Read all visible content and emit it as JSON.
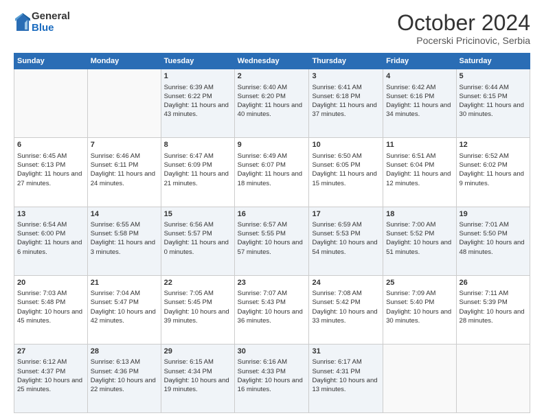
{
  "logo": {
    "general": "General",
    "blue": "Blue"
  },
  "title": "October 2024",
  "location": "Pocerski Pricinovic, Serbia",
  "days_of_week": [
    "Sunday",
    "Monday",
    "Tuesday",
    "Wednesday",
    "Thursday",
    "Friday",
    "Saturday"
  ],
  "weeks": [
    [
      {
        "day": "",
        "sunrise": "",
        "sunset": "",
        "daylight": ""
      },
      {
        "day": "",
        "sunrise": "",
        "sunset": "",
        "daylight": ""
      },
      {
        "day": "1",
        "sunrise": "Sunrise: 6:39 AM",
        "sunset": "Sunset: 6:22 PM",
        "daylight": "Daylight: 11 hours and 43 minutes."
      },
      {
        "day": "2",
        "sunrise": "Sunrise: 6:40 AM",
        "sunset": "Sunset: 6:20 PM",
        "daylight": "Daylight: 11 hours and 40 minutes."
      },
      {
        "day": "3",
        "sunrise": "Sunrise: 6:41 AM",
        "sunset": "Sunset: 6:18 PM",
        "daylight": "Daylight: 11 hours and 37 minutes."
      },
      {
        "day": "4",
        "sunrise": "Sunrise: 6:42 AM",
        "sunset": "Sunset: 6:16 PM",
        "daylight": "Daylight: 11 hours and 34 minutes."
      },
      {
        "day": "5",
        "sunrise": "Sunrise: 6:44 AM",
        "sunset": "Sunset: 6:15 PM",
        "daylight": "Daylight: 11 hours and 30 minutes."
      }
    ],
    [
      {
        "day": "6",
        "sunrise": "Sunrise: 6:45 AM",
        "sunset": "Sunset: 6:13 PM",
        "daylight": "Daylight: 11 hours and 27 minutes."
      },
      {
        "day": "7",
        "sunrise": "Sunrise: 6:46 AM",
        "sunset": "Sunset: 6:11 PM",
        "daylight": "Daylight: 11 hours and 24 minutes."
      },
      {
        "day": "8",
        "sunrise": "Sunrise: 6:47 AM",
        "sunset": "Sunset: 6:09 PM",
        "daylight": "Daylight: 11 hours and 21 minutes."
      },
      {
        "day": "9",
        "sunrise": "Sunrise: 6:49 AM",
        "sunset": "Sunset: 6:07 PM",
        "daylight": "Daylight: 11 hours and 18 minutes."
      },
      {
        "day": "10",
        "sunrise": "Sunrise: 6:50 AM",
        "sunset": "Sunset: 6:05 PM",
        "daylight": "Daylight: 11 hours and 15 minutes."
      },
      {
        "day": "11",
        "sunrise": "Sunrise: 6:51 AM",
        "sunset": "Sunset: 6:04 PM",
        "daylight": "Daylight: 11 hours and 12 minutes."
      },
      {
        "day": "12",
        "sunrise": "Sunrise: 6:52 AM",
        "sunset": "Sunset: 6:02 PM",
        "daylight": "Daylight: 11 hours and 9 minutes."
      }
    ],
    [
      {
        "day": "13",
        "sunrise": "Sunrise: 6:54 AM",
        "sunset": "Sunset: 6:00 PM",
        "daylight": "Daylight: 11 hours and 6 minutes."
      },
      {
        "day": "14",
        "sunrise": "Sunrise: 6:55 AM",
        "sunset": "Sunset: 5:58 PM",
        "daylight": "Daylight: 11 hours and 3 minutes."
      },
      {
        "day": "15",
        "sunrise": "Sunrise: 6:56 AM",
        "sunset": "Sunset: 5:57 PM",
        "daylight": "Daylight: 11 hours and 0 minutes."
      },
      {
        "day": "16",
        "sunrise": "Sunrise: 6:57 AM",
        "sunset": "Sunset: 5:55 PM",
        "daylight": "Daylight: 10 hours and 57 minutes."
      },
      {
        "day": "17",
        "sunrise": "Sunrise: 6:59 AM",
        "sunset": "Sunset: 5:53 PM",
        "daylight": "Daylight: 10 hours and 54 minutes."
      },
      {
        "day": "18",
        "sunrise": "Sunrise: 7:00 AM",
        "sunset": "Sunset: 5:52 PM",
        "daylight": "Daylight: 10 hours and 51 minutes."
      },
      {
        "day": "19",
        "sunrise": "Sunrise: 7:01 AM",
        "sunset": "Sunset: 5:50 PM",
        "daylight": "Daylight: 10 hours and 48 minutes."
      }
    ],
    [
      {
        "day": "20",
        "sunrise": "Sunrise: 7:03 AM",
        "sunset": "Sunset: 5:48 PM",
        "daylight": "Daylight: 10 hours and 45 minutes."
      },
      {
        "day": "21",
        "sunrise": "Sunrise: 7:04 AM",
        "sunset": "Sunset: 5:47 PM",
        "daylight": "Daylight: 10 hours and 42 minutes."
      },
      {
        "day": "22",
        "sunrise": "Sunrise: 7:05 AM",
        "sunset": "Sunset: 5:45 PM",
        "daylight": "Daylight: 10 hours and 39 minutes."
      },
      {
        "day": "23",
        "sunrise": "Sunrise: 7:07 AM",
        "sunset": "Sunset: 5:43 PM",
        "daylight": "Daylight: 10 hours and 36 minutes."
      },
      {
        "day": "24",
        "sunrise": "Sunrise: 7:08 AM",
        "sunset": "Sunset: 5:42 PM",
        "daylight": "Daylight: 10 hours and 33 minutes."
      },
      {
        "day": "25",
        "sunrise": "Sunrise: 7:09 AM",
        "sunset": "Sunset: 5:40 PM",
        "daylight": "Daylight: 10 hours and 30 minutes."
      },
      {
        "day": "26",
        "sunrise": "Sunrise: 7:11 AM",
        "sunset": "Sunset: 5:39 PM",
        "daylight": "Daylight: 10 hours and 28 minutes."
      }
    ],
    [
      {
        "day": "27",
        "sunrise": "Sunrise: 6:12 AM",
        "sunset": "Sunset: 4:37 PM",
        "daylight": "Daylight: 10 hours and 25 minutes."
      },
      {
        "day": "28",
        "sunrise": "Sunrise: 6:13 AM",
        "sunset": "Sunset: 4:36 PM",
        "daylight": "Daylight: 10 hours and 22 minutes."
      },
      {
        "day": "29",
        "sunrise": "Sunrise: 6:15 AM",
        "sunset": "Sunset: 4:34 PM",
        "daylight": "Daylight: 10 hours and 19 minutes."
      },
      {
        "day": "30",
        "sunrise": "Sunrise: 6:16 AM",
        "sunset": "Sunset: 4:33 PM",
        "daylight": "Daylight: 10 hours and 16 minutes."
      },
      {
        "day": "31",
        "sunrise": "Sunrise: 6:17 AM",
        "sunset": "Sunset: 4:31 PM",
        "daylight": "Daylight: 10 hours and 13 minutes."
      },
      {
        "day": "",
        "sunrise": "",
        "sunset": "",
        "daylight": ""
      },
      {
        "day": "",
        "sunrise": "",
        "sunset": "",
        "daylight": ""
      }
    ]
  ]
}
